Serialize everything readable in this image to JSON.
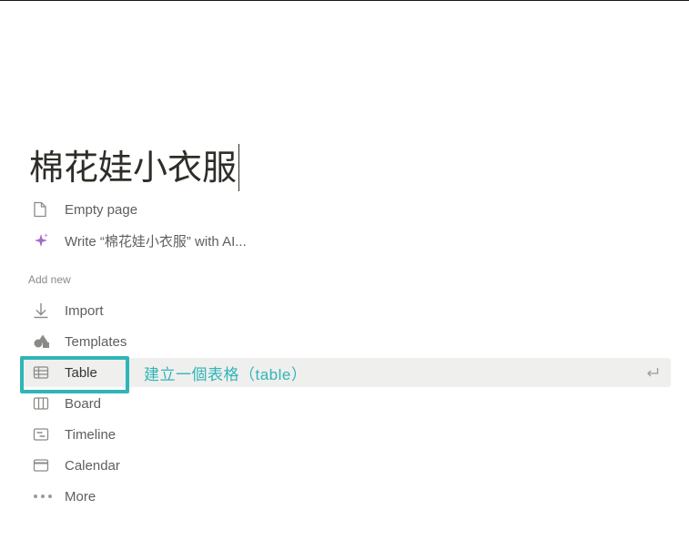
{
  "page": {
    "title": "棉花娃小衣服"
  },
  "quick_actions": [
    {
      "label": "Empty page",
      "icon": "page-icon"
    },
    {
      "label": "Write “棉花娃小衣服” with AI...",
      "icon": "ai-sparkle-icon"
    }
  ],
  "add_new": {
    "section_label": "Add new",
    "items": [
      {
        "label": "Import",
        "icon": "import-icon"
      },
      {
        "label": "Templates",
        "icon": "templates-icon"
      },
      {
        "label": "Table",
        "icon": "table-icon"
      },
      {
        "label": "Board",
        "icon": "board-icon"
      },
      {
        "label": "Timeline",
        "icon": "timeline-icon"
      },
      {
        "label": "Calendar",
        "icon": "calendar-icon"
      },
      {
        "label": "More",
        "icon": "more-icon"
      }
    ]
  },
  "annotation": {
    "hint": "建立一個表格（table）",
    "accent_color": "#2fb5b8"
  },
  "colors": {
    "text": "#37352f",
    "muted": "#5f5e5b",
    "highlight": "#efefee",
    "ai_purple": "#a46bc4"
  }
}
